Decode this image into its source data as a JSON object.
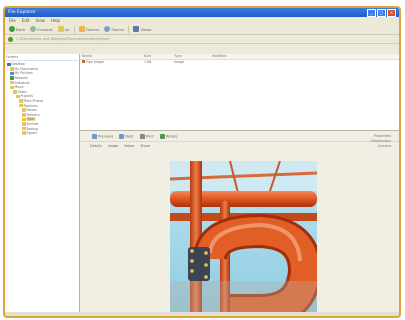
{
  "window": {
    "title": "File Explorer",
    "minimize": "_",
    "maximize": "□",
    "close": "×"
  },
  "menu": [
    "File",
    "Edit",
    "View",
    "Help"
  ],
  "toolbar": {
    "back": "Back",
    "forward": "Forward",
    "up": "Up",
    "folders": "Folders",
    "search": "Search",
    "views": "Views"
  },
  "address": {
    "path": "C:\\Documents and Settings\\Pictures\\Industrial\\Pipes"
  },
  "tree": {
    "header": "Folders",
    "items": [
      "Desktop",
      "My Documents",
      "My Pictures",
      "Network",
      "Industrial",
      "Music",
      "Video",
      "Projects",
      "Plant Photos",
      "Pipelines",
      "Valves",
      "Refinery",
      "Pipes",
      "Archive",
      "Backup",
      "Export"
    ]
  },
  "list": {
    "columns": [
      "Name",
      "Size",
      "Type",
      "Modified"
    ],
    "rows": [
      {
        "name": "Pipe image",
        "size": "1 KB",
        "type": "Image",
        "modified": ""
      }
    ]
  },
  "preview": {
    "tools": [
      "Previous",
      "Next",
      "Print",
      "Rotate"
    ],
    "tabs": [
      "Details",
      "Image",
      "Notes",
      "Share"
    ],
    "info": [
      "Properties",
      "Dimensions",
      "Camera"
    ]
  },
  "colors": {
    "sky": "#9fd3e6",
    "pipe": "#e0541f",
    "frame_border": "#e0a23a",
    "titlebar": "#2a6ad8"
  }
}
